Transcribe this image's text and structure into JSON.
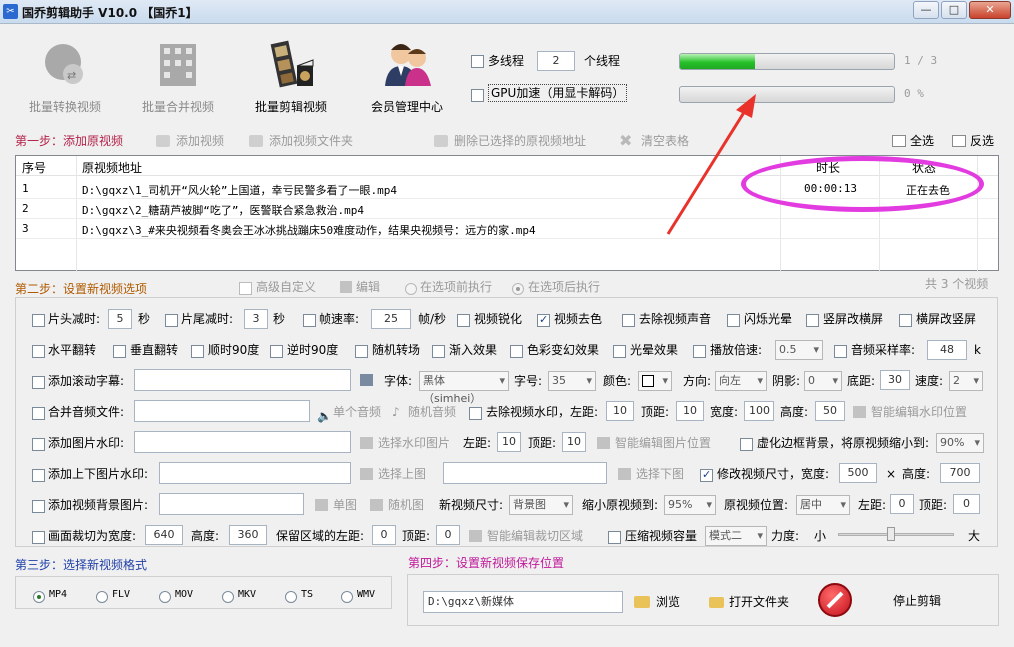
{
  "window": {
    "title": "国乔剪辑助手 V10.0  【国乔1】",
    "min": "—",
    "max": "□",
    "close": "✕"
  },
  "toolbar": {
    "convert": "批量转换视频",
    "merge": "批量合并视频",
    "edit": "批量剪辑视频",
    "member": "会员管理中心"
  },
  "threads": {
    "multi_label": "多线程",
    "count": "2",
    "suffix": "个线程",
    "gpu_label": "GPU加速（用显卡解码）"
  },
  "progress": {
    "p1_text": "1 / 3",
    "p1_value": 0.35,
    "p2_text": "0 %",
    "p2_value": 0
  },
  "step1": {
    "title": "第一步：添加原视频",
    "add_video": "添加视频",
    "add_folder": "添加视频文件夹",
    "delete_selected": "删除已选择的原视频地址",
    "clear_table": "清空表格",
    "select_all": "全选",
    "invert": "反选"
  },
  "table": {
    "headers": [
      "序号",
      "原视频地址",
      "时长",
      "状态"
    ],
    "rows": [
      {
        "no": "1",
        "path": "D:\\gqxz\\1_司机开“风火轮”上国道，幸亏民警多看了一眼.mp4",
        "duration": "00:00:13",
        "status": "正在去色"
      },
      {
        "no": "2",
        "path": "D:\\gqxz\\2_糖葫芦被脚“吃了”，医警联合紧急救治.mp4",
        "duration": "",
        "status": ""
      },
      {
        "no": "3",
        "path": "D:\\gqxz\\3_#来央视频看冬奥会王冰冰挑战蹦床50难度动作，结果央视频号：远方的家.mp4",
        "duration": "",
        "status": ""
      }
    ]
  },
  "step2": {
    "title": "第二步：设置新视频选项",
    "advanced": "高级自定义",
    "edit": "编辑",
    "before": "在选项前执行",
    "after": "在选项后执行",
    "total": "共 3 个视频"
  },
  "opts": {
    "head_cut": "片头减时:",
    "head_val": "5",
    "sec": "秒",
    "tail_cut": "片尾减时:",
    "tail_val": "3",
    "sec2": "秒",
    "fps": "帧速率:",
    "fps_val": "25",
    "fps_unit": "帧/秒",
    "sharpen": "视频锐化",
    "decolor": "视频去色",
    "mute": "去除视频声音",
    "flash": "闪烁光晕",
    "v2h": "竖屏改横屏",
    "h2v": "横屏改竖屏",
    "hflip": "水平翻转",
    "vflip": "垂直翻转",
    "cw90": "顺时90度",
    "ccw90": "逆时90度",
    "rand_trans": "随机转场",
    "fade_in": "渐入效果",
    "color_fx": "色彩变幻效果",
    "halo": "光晕效果",
    "speed": "播放倍速:",
    "speed_val": "0.5",
    "samplerate": "音频采样率:",
    "sr_val": "48",
    "sr_unit": "k",
    "scroll_sub": "添加滚动字幕:",
    "font": "字体:",
    "font_val": "黑体（simhei）",
    "size": "字号:",
    "size_val": "35",
    "color": "颜色:",
    "dir": "方向:",
    "dir_val": "向左",
    "shadow": "阴影:",
    "shadow_val": "0",
    "bottom": "底距:",
    "bottom_val": "30",
    "spd": "速度:",
    "spd_val": "2",
    "merge_audio": "合并音频文件:",
    "single_audio": "单个音频",
    "rand_audio": "随机音频",
    "rm_wm": "去除视频水印，左距:",
    "wm_left": "10",
    "top": "顶距:",
    "wm_top": "10",
    "width": "宽度:",
    "wm_w": "100",
    "height": "高度:",
    "wm_h": "50",
    "smart_wm": "智能编辑水印位置",
    "img_wm": "添加图片水印:",
    "sel_wm_img": "选择水印图片",
    "left": "左距:",
    "img_left": "10",
    "top2": "顶距:",
    "img_top": "10",
    "smart_img": "智能编辑图片位置",
    "blur_bg": "虚化边框背景，将原视频缩小到:",
    "blur_val": "90%",
    "tb_img": "添加上下图片水印:",
    "sel_top": "选择上图",
    "sel_bottom": "选择下图",
    "resize": "修改视频尺寸，宽度:",
    "rs_w": "500",
    "times": "×",
    "height2": "高度:",
    "rs_h": "700",
    "bg_img": "添加视频背景图片:",
    "single_img": "单图",
    "rand_img": "随机图",
    "new_size": "新视频尺寸:",
    "ns_val": "背景图",
    "shrink": "缩小原视频到:",
    "shrink_val": "95%",
    "orig_pos": "原视频位置:",
    "pos_val": "居中",
    "left2": "左距:",
    "pos_left": "0",
    "top3": "顶距:",
    "pos_top": "0",
    "crop": "画面裁切为宽度:",
    "crop_w": "640",
    "height3": "高度:",
    "crop_h": "360",
    "keep_left": "保留区域的左距:",
    "keep_left_val": "0",
    "top4": "顶距:",
    "keep_top_val": "0",
    "smart_crop": "智能编辑裁切区域",
    "compress": "压缩视频容量",
    "mode_val": "模式二",
    "force": "力度:",
    "small": "小",
    "large": "大"
  },
  "step3": {
    "title": "第三步：选择新视频格式",
    "formats": [
      "MP4",
      "FLV",
      "MOV",
      "MKV",
      "TS",
      "WMV"
    ]
  },
  "step4": {
    "title": "第四步：设置新视频保存位置",
    "path": "D:\\gqxz\\新媒体",
    "browse": "浏览",
    "open_folder": "打开文件夹",
    "stop": "停止剪辑"
  },
  "colors": {
    "accent": "#b05a00",
    "annotation": "#e23ce0",
    "arrow": "#e8322a"
  }
}
